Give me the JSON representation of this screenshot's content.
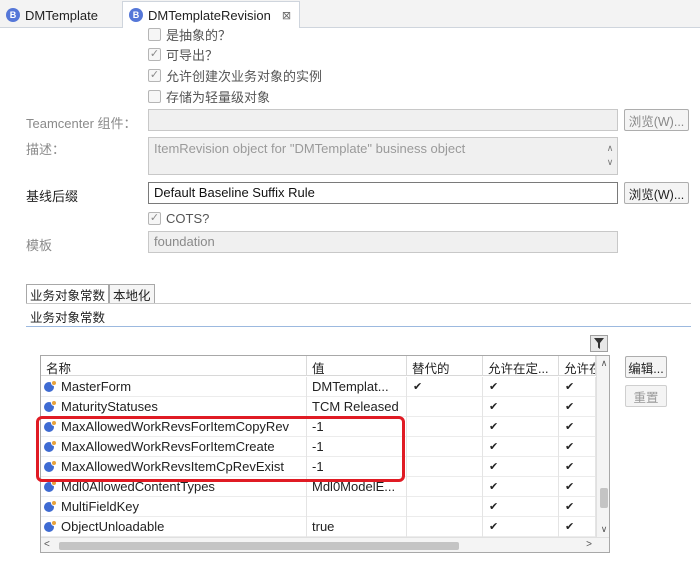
{
  "tabs": [
    {
      "label": "DMTemplate",
      "icon": "business-object-icon",
      "active": false
    },
    {
      "label": "DMTemplateRevision",
      "icon": "business-object-icon",
      "active": true,
      "close": "⊠"
    }
  ],
  "checkboxes": [
    {
      "label": "是抽象的？",
      "checked": false
    },
    {
      "label": "可导出？",
      "checked": true
    },
    {
      "label": "允许创建次业务对象的实例",
      "checked": true
    },
    {
      "label": "存储为轻量级对象",
      "checked": false
    }
  ],
  "fields": {
    "teamcenter_component": {
      "label": "Teamcenter 组件：",
      "value": "",
      "browse": "浏览(W)..."
    },
    "description": {
      "label": "描述：",
      "placeholder": "ItemRevision object for \"DMTemplate\" business object"
    },
    "baseline_suffix": {
      "label": "基线后缀",
      "value": "Default Baseline Suffix Rule",
      "browse": "浏览(W)..."
    },
    "cots": {
      "label": "COTS?",
      "checked": true
    },
    "template": {
      "label": "模板",
      "value": "foundation"
    }
  },
  "subtabs": [
    "业务对象常数",
    "本地化"
  ],
  "section_title": "业务对象常数",
  "table": {
    "headers": [
      "名称",
      "值",
      "替代的",
      "允许在定...",
      "允许在..."
    ],
    "rows": [
      {
        "name": "MasterForm",
        "value": "DMTemplat...",
        "overridden": "✔",
        "c4": "✔",
        "c5": "✔"
      },
      {
        "name": "MaturityStatuses",
        "value": "TCM Released",
        "overridden": "",
        "c4": "✔",
        "c5": "✔"
      },
      {
        "name": "MaxAllowedWorkRevsForItemCopyRev",
        "value": "-1",
        "overridden": "",
        "c4": "✔",
        "c5": "✔"
      },
      {
        "name": "MaxAllowedWorkRevsForItemCreate",
        "value": "-1",
        "overridden": "",
        "c4": "✔",
        "c5": "✔"
      },
      {
        "name": "MaxAllowedWorkRevsItemCpRevExist",
        "value": "-1",
        "overridden": "",
        "c4": "✔",
        "c5": "✔"
      },
      {
        "name": "Mdl0AllowedContentTypes",
        "value": "Mdl0ModelE...",
        "overridden": "",
        "c4": "✔",
        "c5": "✔"
      },
      {
        "name": "MultiFieldKey",
        "value": "",
        "overridden": "",
        "c4": "✔",
        "c5": "✔"
      },
      {
        "name": "ObjectUnloadable",
        "value": "true",
        "overridden": "",
        "c4": "✔",
        "c5": "✔"
      }
    ]
  },
  "buttons": {
    "edit": "编辑...",
    "reset": "重置"
  },
  "colors": {
    "highlight": "#e01b24",
    "accent": "#3f6bd2"
  }
}
